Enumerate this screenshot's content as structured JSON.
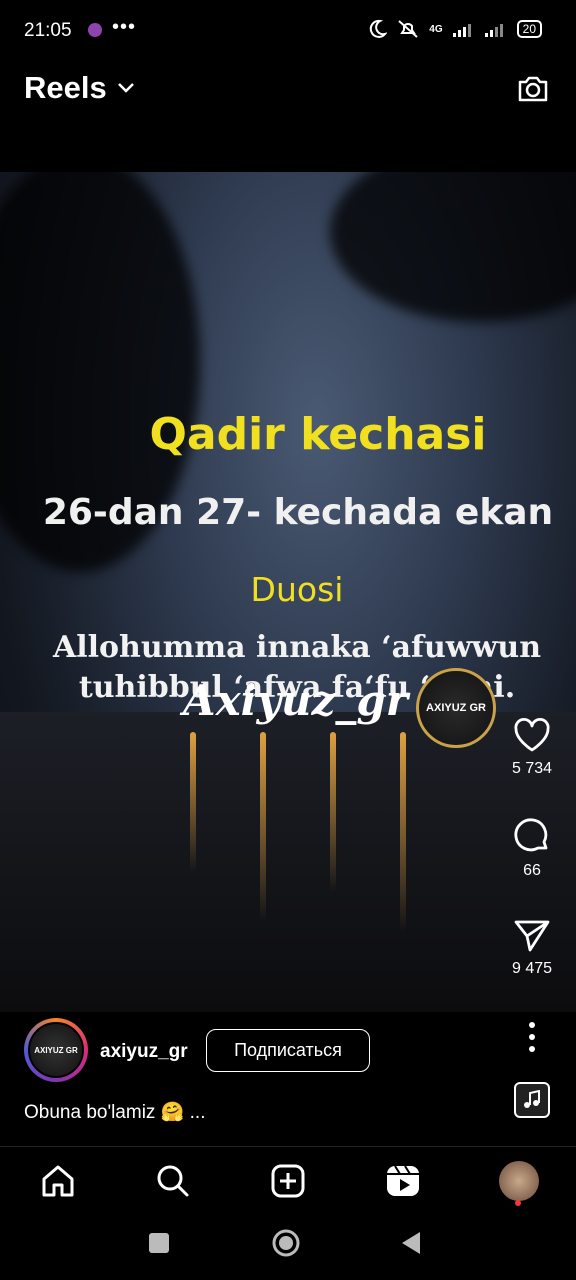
{
  "status_bar": {
    "time": "21:05",
    "more": "•••",
    "network": "4G",
    "battery": "20"
  },
  "header": {
    "title": "Reels"
  },
  "video": {
    "title": "Qadir kechasi",
    "subtitle": "26-dan 27- kechada ekan",
    "prayer_heading": "Duosi",
    "prayer_line1": "Allohumma innaka ‘afuwwun",
    "prayer_line2": "tuhibbul ‘afwa fa‘fu ‘anni.",
    "watermark": "Axiyuz_gr",
    "logo_text": "AXIYUZ GR"
  },
  "actions": {
    "likes": "5 734",
    "comments": "66",
    "shares": "9 475"
  },
  "account": {
    "username": "axiyuz_gr",
    "subscribe_label": "Подписаться",
    "avatar_text": "AXIYUZ GR",
    "caption": "Obuna bo'lamiz 🤗 ..."
  },
  "colors": {
    "background": "#000000",
    "video_title": "#f0e020",
    "notification_dot": "#ff3040"
  }
}
